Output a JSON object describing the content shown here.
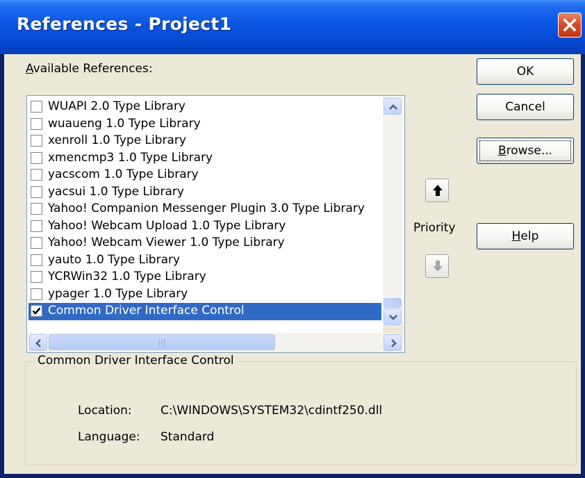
{
  "window": {
    "title": "References - Project1"
  },
  "dialog": {
    "available_label_prefix": "",
    "available_label_accel": "A",
    "available_label_rest": "vailable References:",
    "references": [
      {
        "label": "WUAPI 2.0 Type Library",
        "checked": false,
        "selected": false
      },
      {
        "label": "wuaueng 1.0 Type Library",
        "checked": false,
        "selected": false
      },
      {
        "label": "xenroll 1.0 Type Library",
        "checked": false,
        "selected": false
      },
      {
        "label": "xmencmp3 1.0 Type Library",
        "checked": false,
        "selected": false
      },
      {
        "label": "yacscom 1.0 Type Library",
        "checked": false,
        "selected": false
      },
      {
        "label": "yacsui 1.0 Type Library",
        "checked": false,
        "selected": false
      },
      {
        "label": "Yahoo! Companion Messenger Plugin 3.0 Type Library",
        "checked": false,
        "selected": false
      },
      {
        "label": "Yahoo! Webcam Upload 1.0 Type Library",
        "checked": false,
        "selected": false
      },
      {
        "label": "Yahoo! Webcam Viewer 1.0 Type Library",
        "checked": false,
        "selected": false
      },
      {
        "label": "yauto 1.0 Type Library",
        "checked": false,
        "selected": false
      },
      {
        "label": "YCRWin32 1.0 Type Library",
        "checked": false,
        "selected": false
      },
      {
        "label": "ypager 1.0 Type Library",
        "checked": false,
        "selected": false
      },
      {
        "label": "Common Driver Interface Control",
        "checked": true,
        "selected": true
      }
    ],
    "buttons": {
      "ok": "OK",
      "cancel": "Cancel",
      "browse_accel": "B",
      "browse_rest": "rowse...",
      "help_accel": "H",
      "help_rest": "elp"
    },
    "priority_label": "Priority",
    "details": {
      "group_title": "Common Driver Interface Control",
      "location_label": "Location:",
      "location_value": "C:\\WINDOWS\\SYSTEM32\\cdintf250.dll",
      "language_label": "Language:",
      "language_value": "Standard"
    }
  },
  "icons": {
    "close": "close-icon",
    "scroll_up": "chevron-up-icon",
    "scroll_down": "chevron-down-icon",
    "scroll_left": "chevron-left-icon",
    "scroll_right": "chevron-right-icon",
    "priority_up": "arrow-up-icon",
    "priority_down": "arrow-down-icon",
    "check": "checkmark-icon"
  },
  "colors": {
    "titlebar": "#0a55e0",
    "selection": "#316ac5",
    "close_button": "#d6502c",
    "dialog_face": "#ece9d8"
  }
}
